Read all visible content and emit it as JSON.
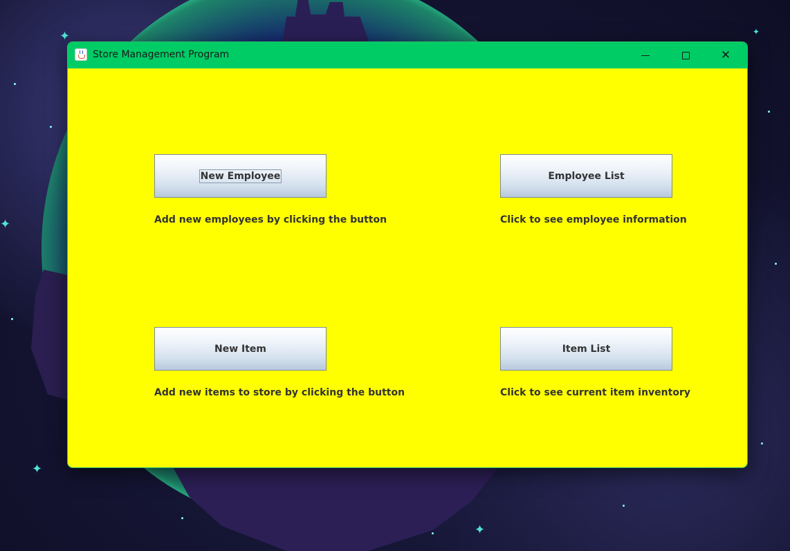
{
  "window": {
    "title": "Store Management Program",
    "title_bar_color": "#00cc66",
    "content_bg_color": "#ffff00"
  },
  "controls": {
    "minimize_icon": "minimize-icon",
    "maximize_icon": "maximize-icon",
    "close_icon": "close-icon",
    "close_glyph": "✕"
  },
  "employee": {
    "new_button_label": "New Employee",
    "new_description": "Add new employees by clicking the button",
    "list_button_label": "Employee List",
    "list_description": "Click to see employee information"
  },
  "item": {
    "new_button_label": "New Item",
    "new_description": "Add new items to store by clicking the button",
    "list_button_label": "Item List",
    "list_description": "Click to see current item inventory"
  }
}
